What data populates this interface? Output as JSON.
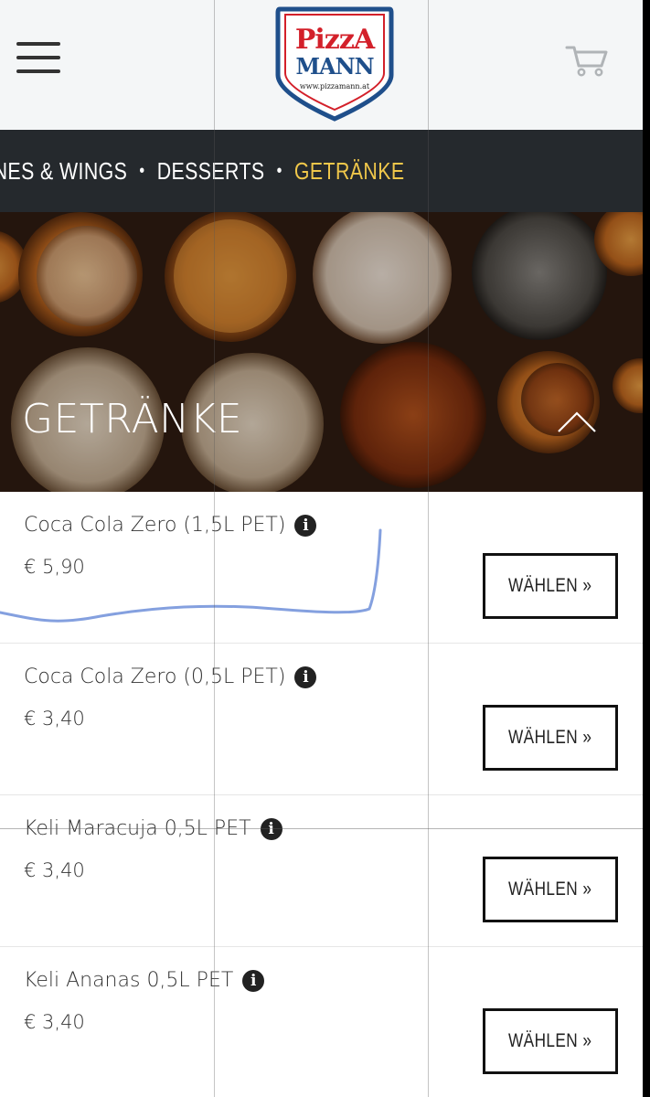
{
  "header": {
    "logo_line1": "PizzA",
    "logo_line2": "MANN",
    "logo_url": "www.pizzamann.at"
  },
  "catnav": {
    "items": [
      "ENES & WINGS",
      "DESSERTS",
      "GETRÄNKE"
    ],
    "separator": "•",
    "active_index": 2
  },
  "hero": {
    "title": "GETRÄNKE"
  },
  "products": [
    {
      "name": "Coca Cola Zero (1,5L PET)",
      "price": "€ 5,90",
      "button": "WÄHLEN »"
    },
    {
      "name": "Coca Cola Zero (0,5L PET)",
      "price": "€ 3,40",
      "button": "WÄHLEN »"
    },
    {
      "name": "Keli Maracuja 0,5L PET",
      "price": "€ 3,40",
      "button": "WÄHLEN »"
    },
    {
      "name": "Keli Ananas 0,5L PET",
      "price": "€ 3,40",
      "button": "WÄHLEN »"
    }
  ],
  "icons": {
    "info": "info-icon",
    "menu": "hamburger-menu-icon",
    "cart": "cart-icon",
    "collapse": "chevron-up-icon"
  },
  "colors": {
    "nav_bg": "#25292d",
    "active_category": "#f0c74a",
    "logo_red": "#d3202a",
    "logo_blue": "#1f4f8b"
  }
}
